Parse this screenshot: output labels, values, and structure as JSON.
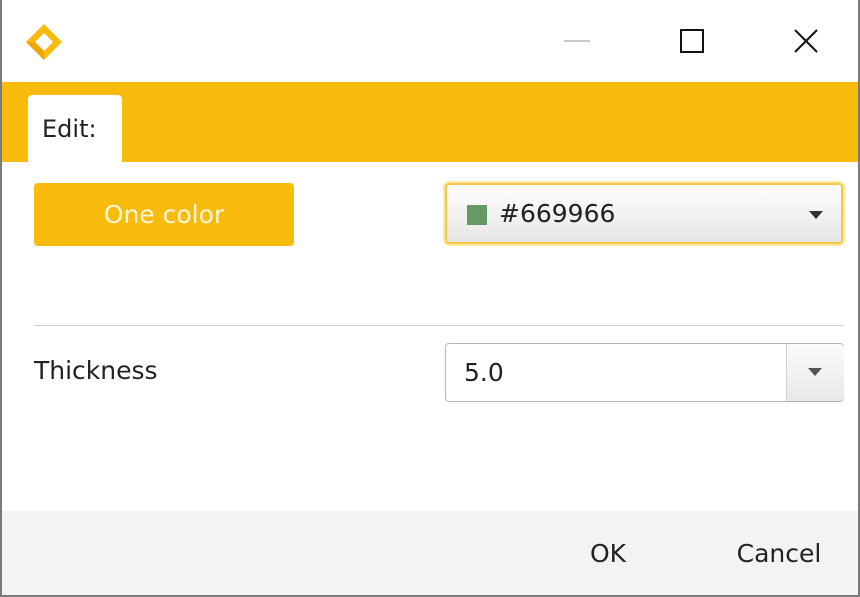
{
  "window": {
    "minimize_icon": "minimize-icon",
    "maximize_icon": "maximize-icon",
    "close_icon": "close-icon",
    "logo_icon": "app-logo-icon"
  },
  "tabs": [
    {
      "label": "Edit:"
    }
  ],
  "style": {
    "mode_button_label": "One color",
    "color_value": "#669966",
    "swatch_color": "#669966"
  },
  "thickness": {
    "label": "Thickness",
    "value": "5.0"
  },
  "footer": {
    "ok_label": "OK",
    "cancel_label": "Cancel"
  },
  "colors": {
    "accent": "#f9bb0c",
    "footer_bg": "#f3f3f3"
  }
}
